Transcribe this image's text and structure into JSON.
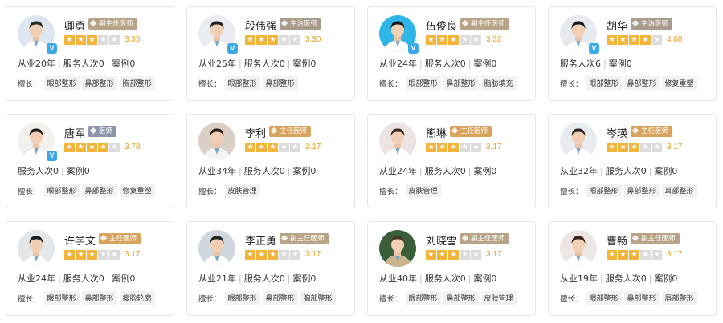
{
  "colors": {
    "deputy_chief": "#b7a487",
    "chief": "#d8a35d",
    "attending": "#a89c8c",
    "doctor": "#8e95aa",
    "star": "#f2b53b",
    "rating": "#e3a024"
  },
  "labels": {
    "specialty_prefix": "擅长：",
    "separator": "|"
  },
  "doctors": [
    {
      "name": "卿勇",
      "title": "副主任医师",
      "title_color": "#b7a487",
      "stars": 3,
      "rating": "3.35",
      "verified": true,
      "photo_bg": "#dde6ee",
      "coat": "#ffffff",
      "hair": "#2b2b2b",
      "stats": [
        "从业20年",
        "服务人次0",
        "案例0"
      ],
      "tags": [
        "眼部整形",
        "鼻部整形",
        "胸部整形"
      ]
    },
    {
      "name": "段伟强",
      "title": "主治医师",
      "title_color": "#a89c8c",
      "stars": 3,
      "rating": "3.30",
      "verified": true,
      "photo_bg": "#e9edf1",
      "coat": "#ffffff",
      "hair": "#222222",
      "stats": [
        "从业25年",
        "服务人次0",
        "案例0"
      ],
      "tags": [
        "眼部整形",
        "鼻部整形"
      ]
    },
    {
      "name": "伍俊良",
      "title": "副主任医师",
      "title_color": "#b7a487",
      "stars": 3,
      "rating": "3.32",
      "verified": true,
      "photo_bg": "#2fb6e6",
      "coat": "#ffffff",
      "hair": "#1d1d1d",
      "stats": [
        "从业24年",
        "服务人次0",
        "案例0"
      ],
      "tags": [
        "眼部整形",
        "鼻部整形",
        "脂肪填充"
      ]
    },
    {
      "name": "胡华",
      "title": "主治医师",
      "title_color": "#a89c8c",
      "stars": 4,
      "rating": "4.08",
      "verified": true,
      "photo_bg": "#e6e9ed",
      "coat": "#ffffff",
      "hair": "#1a1a1a",
      "stats": [
        "服务人次6",
        "案例0"
      ],
      "tags": [
        "眼部整形",
        "鼻部整形",
        "修复重塑"
      ]
    },
    {
      "name": "唐军",
      "title": "医师",
      "title_color": "#8e95aa",
      "stars": 4,
      "rating": "3.78",
      "verified": true,
      "photo_bg": "#f3f1ee",
      "coat": "#ffffff",
      "hair": "#1e1e1e",
      "stats": [
        "服务人次0",
        "案例0"
      ],
      "tags": [
        "眼部整形",
        "鼻部整形",
        "修复重塑"
      ]
    },
    {
      "name": "李利",
      "title": "主任医师",
      "title_color": "#d8a35d",
      "stars": 3,
      "rating": "3.17",
      "verified": false,
      "photo_bg": "#d9cfc5",
      "coat": "#f4f4f4",
      "hair": "#2a1f18",
      "stats": [
        "从业34年",
        "服务人次0",
        "案例0"
      ],
      "tags": [
        "皮肤管理"
      ]
    },
    {
      "name": "熊琳",
      "title": "主任医师",
      "title_color": "#d8a35d",
      "stars": 3,
      "rating": "3.17",
      "verified": false,
      "photo_bg": "#ebe4e2",
      "coat": "#ffffff",
      "hair": "#3a2a22",
      "stats": [
        "从业24年",
        "服务人次0",
        "案例0"
      ],
      "tags": [
        "皮肤管理"
      ]
    },
    {
      "name": "岑瑛",
      "title": "主任医师",
      "title_color": "#d8a35d",
      "stars": 3,
      "rating": "3.17",
      "verified": false,
      "photo_bg": "#e8ebef",
      "coat": "#ffffff",
      "hair": "#2e241e",
      "stats": [
        "从业32年",
        "服务人次0",
        "案例0"
      ],
      "tags": [
        "眼部整形",
        "鼻部整形",
        "耳部整形"
      ]
    },
    {
      "name": "许学文",
      "title": "主任医师",
      "title_color": "#d8a35d",
      "stars": 3,
      "rating": "3.17",
      "verified": false,
      "photo_bg": "#e3e7ea",
      "coat": "#ffffff",
      "hair": "#1b1b1b",
      "stats": [
        "从业24年",
        "服务人次0",
        "案例0"
      ],
      "tags": [
        "眼部整形",
        "鼻部整形",
        "瘦脸轮廓"
      ]
    },
    {
      "name": "李正勇",
      "title": "副主任医师",
      "title_color": "#b7a487",
      "stars": 3,
      "rating": "3.17",
      "verified": false,
      "photo_bg": "#cfd6dd",
      "coat": "#ffffff",
      "hair": "#242424",
      "stats": [
        "从业21年",
        "服务人次0",
        "案例0"
      ],
      "tags": [
        "眼部整形",
        "鼻部整形",
        "胸部整形"
      ]
    },
    {
      "name": "刘晓雪",
      "title": "副主任医师",
      "title_color": "#b7a487",
      "stars": 3,
      "rating": "3.17",
      "verified": false,
      "photo_bg": "#3b5e3a",
      "coat": "#c9b48b",
      "hair": "#4a3a2c",
      "stats": [
        "从业40年",
        "服务人次0",
        "案例0"
      ],
      "tags": [
        "眼部整形",
        "鼻部整形",
        "皮肤管理"
      ]
    },
    {
      "name": "曹畅",
      "title": "副主任医师",
      "title_color": "#b7a487",
      "stars": 3,
      "rating": "3.17",
      "verified": false,
      "photo_bg": "#ece6e4",
      "coat": "#ffffff",
      "hair": "#3a2418",
      "stats": [
        "从业19年",
        "服务人次0",
        "案例0"
      ],
      "tags": [
        "眼部整形",
        "鼻部整形",
        "唇部整形"
      ]
    }
  ]
}
